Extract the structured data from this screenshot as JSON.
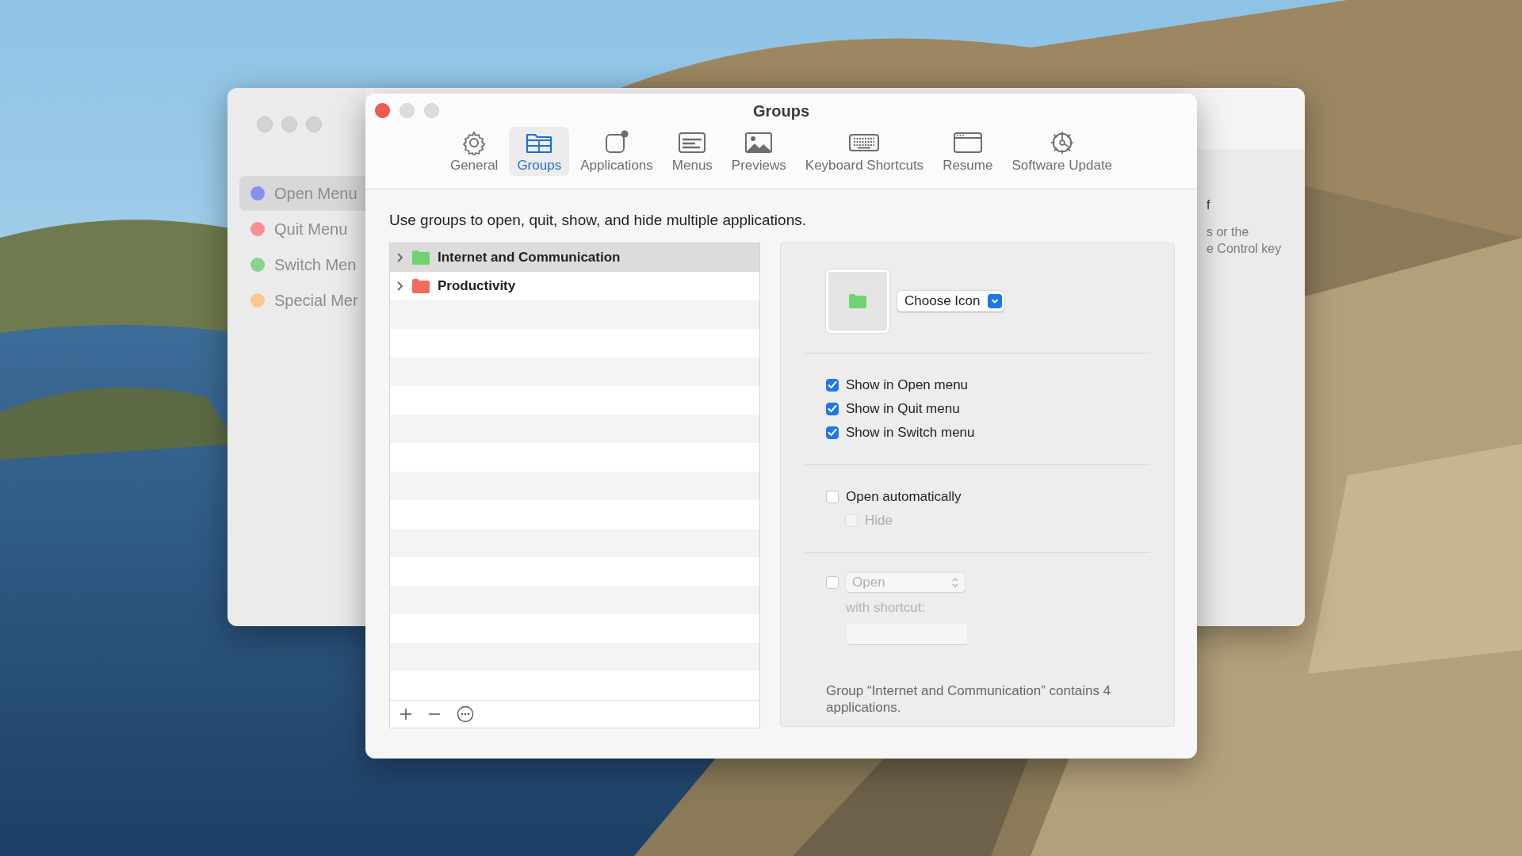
{
  "background_window": {
    "sidebar": [
      {
        "label": "Open Menu",
        "color": "#8b8ef0",
        "selected": true
      },
      {
        "label": "Quit Menu",
        "color": "#f58f92",
        "selected": false
      },
      {
        "label": "Switch Men",
        "color": "#86d48f",
        "selected": false
      },
      {
        "label": "Special Mer",
        "color": "#f7c98d",
        "selected": false
      }
    ],
    "text_fragments": [
      "f",
      "s or the",
      "e Control key"
    ]
  },
  "window": {
    "title": "Groups",
    "tabs": [
      {
        "label": "General",
        "selected": false
      },
      {
        "label": "Groups",
        "selected": true
      },
      {
        "label": "Applications",
        "selected": false
      },
      {
        "label": "Menus",
        "selected": false
      },
      {
        "label": "Previews",
        "selected": false
      },
      {
        "label": "Keyboard Shortcuts",
        "selected": false
      },
      {
        "label": "Resume",
        "selected": false
      },
      {
        "label": "Software Update",
        "selected": false
      }
    ],
    "description": "Use groups to open, quit, show, and hide multiple applications.",
    "groups": [
      {
        "name": "Internet and Communication",
        "color": "#6fd36f",
        "selected": true,
        "expanded": false
      },
      {
        "name": "Productivity",
        "color": "#f26a5c",
        "selected": false,
        "expanded": false
      }
    ],
    "choose_icon": {
      "label": "Choose Icon"
    },
    "menu_options": [
      {
        "label": "Show in Open menu",
        "checked": true,
        "disabled": false
      },
      {
        "label": "Show in Quit menu",
        "checked": true,
        "disabled": false
      },
      {
        "label": "Show in Switch menu",
        "checked": true,
        "disabled": false
      }
    ],
    "auto_option": {
      "label": "Open automatically",
      "checked": false,
      "disabled": false,
      "children": [
        {
          "label": "Hide",
          "checked": false,
          "disabled": true
        }
      ]
    },
    "shortcut": {
      "checked": false,
      "disabled": true,
      "action": "Open",
      "caption": "with shortcut:"
    },
    "summary": "Group “Internet and Communication” contains 4 applications."
  }
}
